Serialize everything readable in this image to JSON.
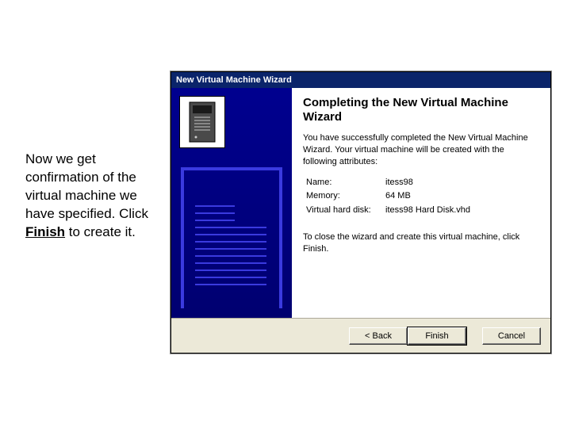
{
  "caption": {
    "text_pre": "Now we get confirmation of the virtual machine we have specified. Click ",
    "bold": "Finish",
    "text_post": " to create it."
  },
  "dialog": {
    "title": "New Virtual Machine Wizard",
    "heading": "Completing the New Virtual Machine Wizard",
    "intro": "You have successfully completed the New Virtual Machine Wizard. Your virtual machine will be created with the following attributes:",
    "attributes": {
      "name_label": "Name:",
      "name_value": "itess98",
      "memory_label": "Memory:",
      "memory_value": "64 MB",
      "vhd_label": "Virtual hard disk:",
      "vhd_value": "itess98 Hard Disk.vhd"
    },
    "close_text": "To close the wizard and create this virtual machine, click Finish.",
    "buttons": {
      "back": "< Back",
      "finish": "Finish",
      "cancel": "Cancel"
    }
  }
}
